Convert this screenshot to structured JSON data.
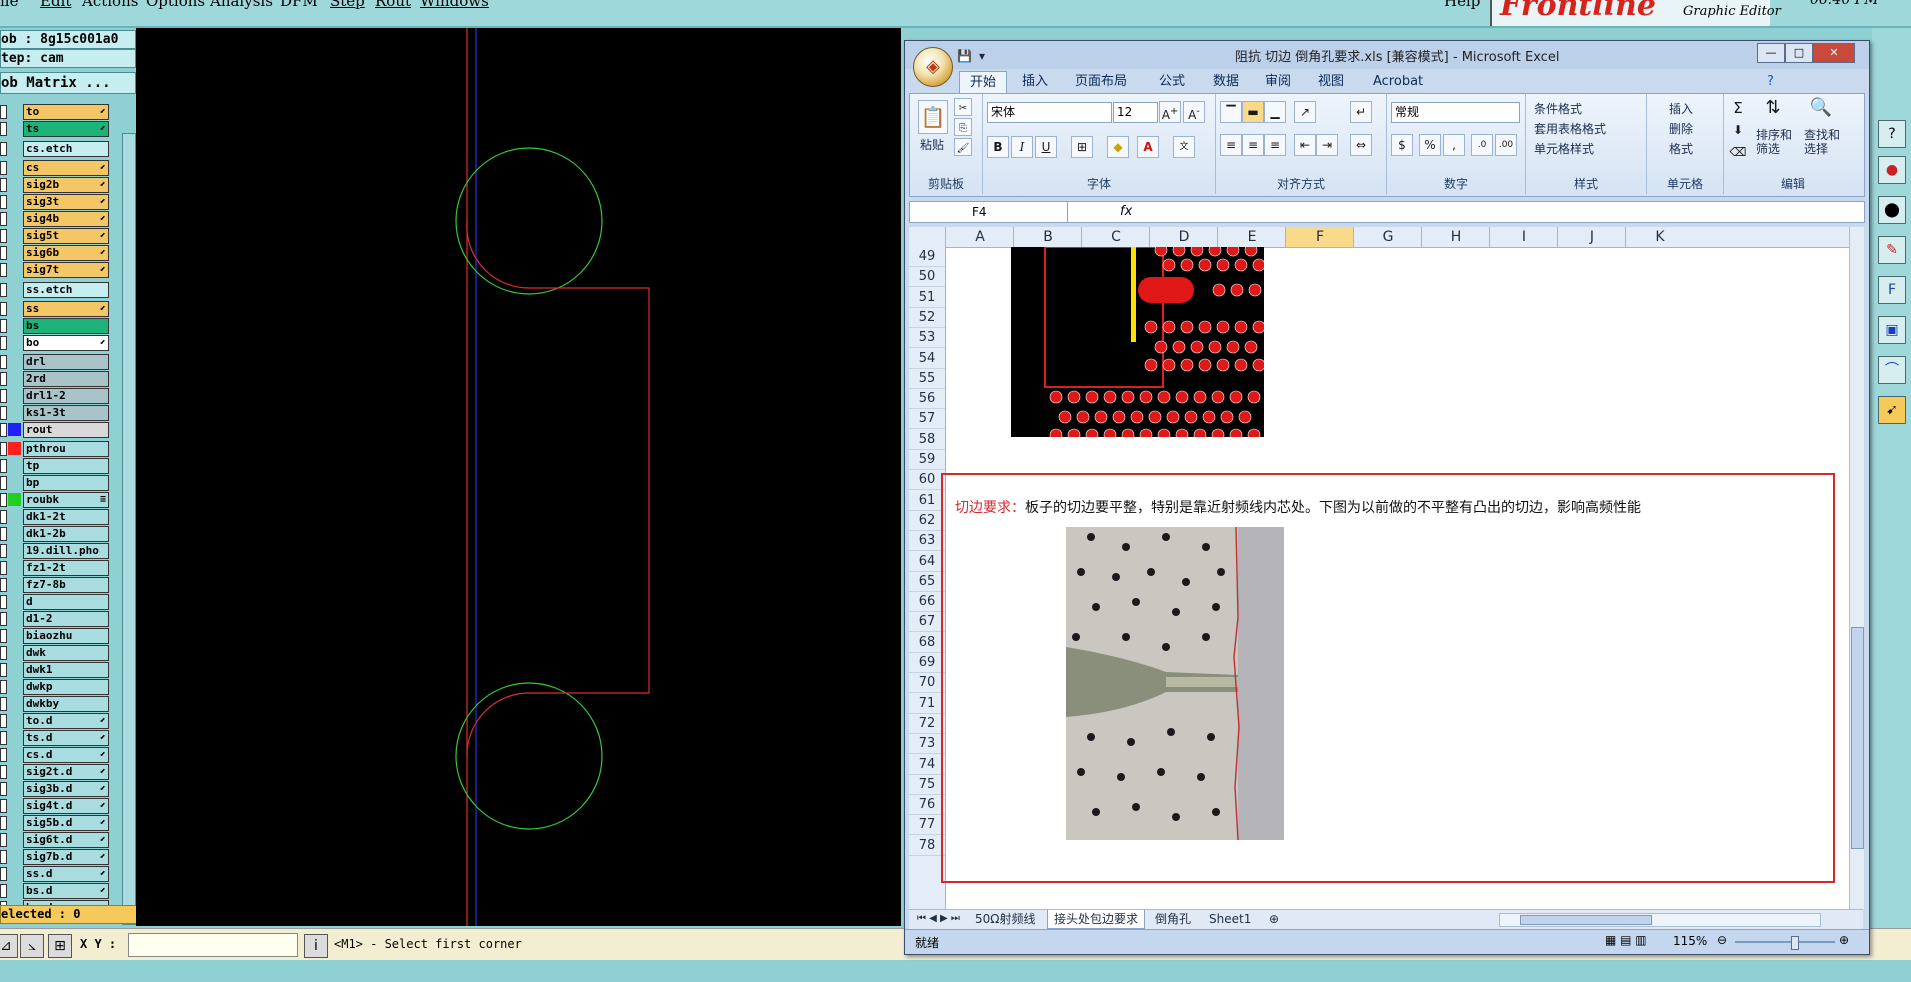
{
  "genesis": {
    "menu": [
      "ile",
      "Edit",
      "Actions",
      "Options",
      "Analysis",
      "DFM",
      "Step",
      "Rout",
      "Windows"
    ],
    "help": "Help",
    "brand": "Frontline",
    "graphic_editor": "Graphic Editor",
    "clock": "06:40 PM",
    "job": "ob : 8g15c001a0",
    "step": "tep: cam",
    "matrix_button": "ob Matrix ...",
    "layers": [
      {
        "name": "to",
        "color": "#f4c766",
        "mark": "⬋"
      },
      {
        "name": "ts",
        "color": "#1db47a",
        "mark": "⬋"
      },
      {
        "name": "cs.etch",
        "color": "#c6eef0",
        "mark": ""
      },
      {
        "name": "cs",
        "color": "#f4c766",
        "mark": "⬋"
      },
      {
        "name": "sig2b",
        "color": "#f4c766",
        "mark": "⬋"
      },
      {
        "name": "sig3t",
        "color": "#f4c766",
        "mark": "⬋"
      },
      {
        "name": "sig4b",
        "color": "#f4c766",
        "mark": "⬋"
      },
      {
        "name": "sig5t",
        "color": "#f4c766",
        "mark": "⬋"
      },
      {
        "name": "sig6b",
        "color": "#f4c766",
        "mark": "⬋"
      },
      {
        "name": "sig7t",
        "color": "#f4c766",
        "mark": "⬋"
      },
      {
        "name": "ss.etch",
        "color": "#c6eef0",
        "mark": ""
      },
      {
        "name": "ss",
        "color": "#f4c766",
        "mark": "⬋"
      },
      {
        "name": "bs",
        "color": "#1db47a",
        "mark": ""
      },
      {
        "name": "bo",
        "color": "#ffffff",
        "mark": "⬋"
      },
      {
        "name": "drl",
        "color": "#a9c3c9",
        "mark": ""
      },
      {
        "name": "2rd",
        "color": "#a9c3c9",
        "mark": ""
      },
      {
        "name": "drl1-2",
        "color": "#a9c3c9",
        "mark": ""
      },
      {
        "name": "ks1-3t",
        "color": "#a9c3c9",
        "mark": ""
      },
      {
        "name": "rout",
        "color": "#d9d9d9",
        "mark": ""
      },
      {
        "name": "pthrou",
        "color": "#a8dcdf",
        "mark": ""
      },
      {
        "name": "tp",
        "color": "#a8dcdf",
        "mark": ""
      },
      {
        "name": "bp",
        "color": "#a8dcdf",
        "mark": ""
      },
      {
        "name": "roubk",
        "color": "#a8dcdf",
        "mark": "≡"
      },
      {
        "name": "dk1-2t",
        "color": "#a8dcdf",
        "mark": ""
      },
      {
        "name": "dk1-2b",
        "color": "#a8dcdf",
        "mark": ""
      },
      {
        "name": "19.dill.pho",
        "color": "#a8dcdf",
        "mark": ""
      },
      {
        "name": "fz1-2t",
        "color": "#a8dcdf",
        "mark": ""
      },
      {
        "name": "fz7-8b",
        "color": "#a8dcdf",
        "mark": ""
      },
      {
        "name": "d",
        "color": "#a8dcdf",
        "mark": ""
      },
      {
        "name": "d1-2",
        "color": "#a8dcdf",
        "mark": ""
      },
      {
        "name": "biaozhu",
        "color": "#a8dcdf",
        "mark": ""
      },
      {
        "name": "dwk",
        "color": "#a8dcdf",
        "mark": ""
      },
      {
        "name": "dwk1",
        "color": "#a8dcdf",
        "mark": ""
      },
      {
        "name": "dwkp",
        "color": "#a8dcdf",
        "mark": ""
      },
      {
        "name": "dwkby",
        "color": "#a8dcdf",
        "mark": ""
      },
      {
        "name": "to.d",
        "color": "#a8dcdf",
        "mark": "⬋"
      },
      {
        "name": "ts.d",
        "color": "#a8dcdf",
        "mark": "⬋"
      },
      {
        "name": "cs.d",
        "color": "#a8dcdf",
        "mark": "⬋"
      },
      {
        "name": "sig2t.d",
        "color": "#a8dcdf",
        "mark": "⬋"
      },
      {
        "name": "sig3b.d",
        "color": "#a8dcdf",
        "mark": "⬋"
      },
      {
        "name": "sig4t.d",
        "color": "#a8dcdf",
        "mark": "⬋"
      },
      {
        "name": "sig5b.d",
        "color": "#a8dcdf",
        "mark": "⬋"
      },
      {
        "name": "sig6t.d",
        "color": "#a8dcdf",
        "mark": "⬋"
      },
      {
        "name": "sig7b.d",
        "color": "#a8dcdf",
        "mark": "⬋"
      },
      {
        "name": "ss.d",
        "color": "#a8dcdf",
        "mark": "⬋"
      },
      {
        "name": "bs.d",
        "color": "#a8dcdf",
        "mark": "⬋"
      },
      {
        "name": "bo.d",
        "color": "#a8dcdf",
        "mark": "⬋"
      }
    ],
    "swatches": {
      "rout": "#2020ff",
      "pthrou": "#ff2020",
      "roubk": "#20d020"
    },
    "selected": "elected : 0",
    "xy_label": "X Y :",
    "xy_value": "",
    "status": "<M1> - Select first corner"
  },
  "excel": {
    "title": "阻抗  切边  倒角孔要求.xls  [兼容模式]  -  Microsoft Excel",
    "tabs": [
      "开始",
      "插入",
      "页面布局",
      "公式",
      "数据",
      "审阅",
      "视图",
      "Acrobat"
    ],
    "clipboard": {
      "paste": "粘贴",
      "group": "剪贴板"
    },
    "font": {
      "name": "宋体",
      "size": "12",
      "group": "字体"
    },
    "alignment": {
      "group": "对齐方式"
    },
    "number": {
      "format": "常规",
      "group": "数字"
    },
    "styles": {
      "conditional": "条件格式",
      "table": "套用表格格式",
      "cell": "单元格样式",
      "group": "样式"
    },
    "cells": {
      "insert": "插入",
      "delete": "删除",
      "format": "格式",
      "group": "单元格"
    },
    "editing": {
      "sort": "排序和\n筛选",
      "find": "查找和\n选择",
      "group": "编辑"
    },
    "namebox": "F4",
    "fx": "fx",
    "columns": [
      "A",
      "B",
      "C",
      "D",
      "E",
      "F",
      "G",
      "H",
      "I",
      "J",
      "K"
    ],
    "rows": [
      "49",
      "50",
      "51",
      "52",
      "53",
      "54",
      "55",
      "56",
      "57",
      "58",
      "59",
      "60",
      "61",
      "62",
      "63",
      "64",
      "65",
      "66",
      "67",
      "68",
      "69",
      "70",
      "71",
      "72",
      "73",
      "74",
      "75",
      "76",
      "77",
      "78"
    ],
    "note_label": "切边要求：",
    "note_text": "板子的切边要平整，特别是靠近射频线内芯处。下图为以前做的不平整有凸出的切边，影响高频性能",
    "sheets": [
      "50Ω射频线",
      "接头处包边要求",
      "倒角孔",
      "Sheet1"
    ],
    "status_ready": "就绪",
    "zoom": "115%"
  }
}
